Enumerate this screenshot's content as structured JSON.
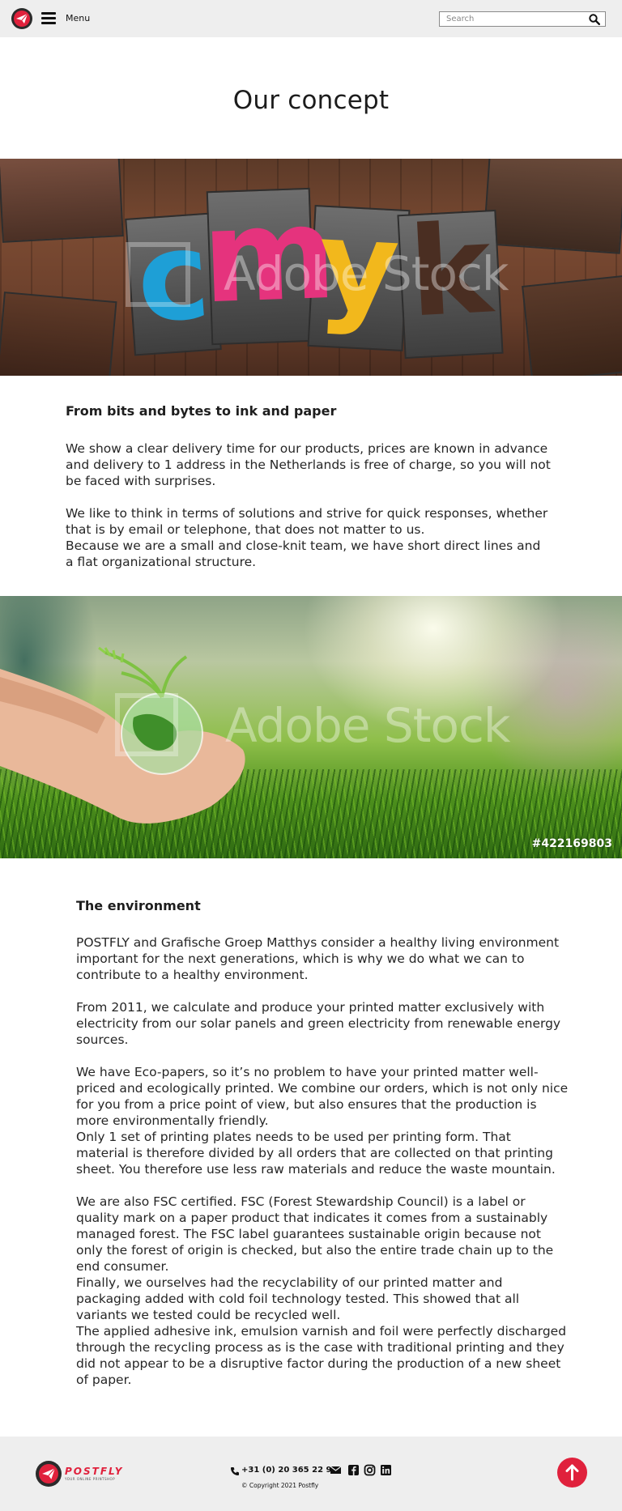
{
  "header": {
    "menu_label": "Menu",
    "search_placeholder": "Search"
  },
  "page_title": "Our concept",
  "hero1": {
    "letters": [
      "c",
      "m",
      "y",
      "k"
    ],
    "watermark": "Adobe Stock"
  },
  "section1": {
    "heading": "From bits and bytes to ink and paper",
    "p1": "We show a clear delivery time for our products, prices are known in advance and delivery to 1 address in the Netherlands is free of charge, so you will not be faced with surprises.",
    "p2": "We like to think in terms of solutions and strive for quick responses, whether that is by email or telephone, that does not matter to us.",
    "p3": "Because we are a small and close-knit team, we have short direct lines and a flat organizational structure."
  },
  "hero2": {
    "watermark": "Adobe Stock",
    "stock_id": "#422169803"
  },
  "section2": {
    "heading": "The environment",
    "p1": "POSTFLY and Grafische Groep Matthys consider a healthy living environment important for the next generations, which is why we do what we can to contribute to a healthy environment.",
    "p2": "From 2011, we calculate and produce your printed matter exclusively with electricity from our solar panels and green electricity from renewable energy sources.",
    "p3": "We have Eco-papers, so it’s no problem to have your printed matter well-priced and ecologically printed. We combine our orders, which is not only nice for you from a price point of view, but also ensures that the production is more environmentally friendly.",
    "p4": "Only 1 set of printing plates needs to be used per printing form. That material is therefore divided by all orders that are collected on that printing sheet. You therefore use less raw materials and reduce the waste mountain.",
    "p5": "We are also FSC certified. FSC (Forest Stewardship Council) is a label or quality mark on a paper product that indicates it comes from a sustainably managed forest. The FSC label guarantees sustainable origin because not only the forest of origin is checked, but also the entire trade chain up to the end consumer.",
    "p6": "Finally, we ourselves had the recyclability of our printed matter and packaging added with cold foil technology tested. This showed that all variants we tested could be recycled well.",
    "p7": "The applied adhesive ink, emulsion varnish and foil were perfectly discharged through the recycling process as is the case with traditional printing and they did not appear to be a disruptive factor during the production of a new sheet of paper."
  },
  "footer": {
    "brand": "POSTFLY",
    "tagline": "YOUR ONLINE PRINTSHOP",
    "phone": "+31 (0) 20 365 22 93",
    "copyright": "© Copyright 2021 Postfly",
    "social_icons": [
      "mail-icon",
      "facebook-icon",
      "instagram-icon",
      "linkedin-icon"
    ],
    "accent_color": "#e0213c"
  }
}
